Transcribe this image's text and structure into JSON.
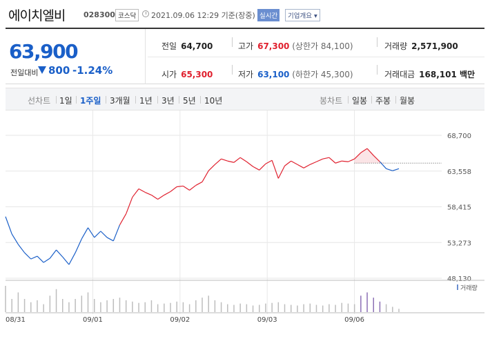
{
  "header": {
    "name": "에이치엘비",
    "code": "028300",
    "market": "코스닥",
    "timestamp": "2021.09.06 12:29 기준(장중)",
    "realtime_label": "실시간",
    "company_label": "기업개요 ▾"
  },
  "price": {
    "current": "63,900",
    "change_label": "전일대비",
    "change": "800",
    "change_pct": "-1.24%"
  },
  "stats": {
    "prev_label": "전일",
    "prev": "64,700",
    "high_label": "고가",
    "high": "67,300",
    "upper_limit": "(상한가 84,100)",
    "volume_label": "거래량",
    "volume": "2,571,900",
    "open_label": "시가",
    "open": "65,300",
    "low_label": "저가",
    "low": "63,100",
    "lower_limit": "(하한가 45,300)",
    "amount_label": "거래대금",
    "amount": "168,101 백만"
  },
  "tabs": {
    "line_chart_label": "선차트",
    "periods": [
      "1일",
      "1주일",
      "3개월",
      "1년",
      "3년",
      "5년",
      "10년"
    ],
    "active_period": "1주일",
    "candle_chart_label": "봉차트",
    "candles": [
      "일봉",
      "주봉",
      "월봉"
    ]
  },
  "colors": {
    "up": "#e0202e",
    "down": "#1a5fc8",
    "accent": "#1a5fc8"
  },
  "chart_data": {
    "type": "line",
    "xlabel": "",
    "ylabel": "",
    "x": [
      "08/31",
      "09/01",
      "09/02",
      "09/03",
      "09/06"
    ],
    "yticks": [
      "68,700",
      "63,558",
      "58,415",
      "53,273",
      "48,130"
    ],
    "ylim": [
      48130,
      68700
    ],
    "reference_line": 64700,
    "series": [
      {
        "values": [
          57000,
          54500,
          53000,
          51800,
          50900,
          51300,
          50400,
          51000,
          52200,
          51200,
          50100,
          51800,
          53800,
          55400,
          54000,
          54900,
          54000,
          53500,
          55800,
          57400,
          59800,
          61000,
          60500,
          60100,
          59500,
          60100,
          60600,
          61300,
          61400,
          60800,
          61500,
          62000,
          63600,
          64500,
          65300,
          65000,
          64800,
          65500,
          64900,
          64200,
          63700,
          64600,
          65100,
          62500,
          64300,
          65000,
          64500,
          64000,
          64500,
          64900,
          65300,
          65500,
          64700,
          65000,
          64900,
          65300,
          66200,
          66800,
          65800,
          64900,
          63900,
          63600,
          63900
        ]
      }
    ],
    "grid": "horizontal",
    "volume_legend": "거래량",
    "volume_series": [
      4,
      2,
      3,
      2,
      1.5,
      1.8,
      1.2,
      2.5,
      3.5,
      2,
      1.5,
      2,
      2.5,
      3,
      2,
      1.5,
      1.8,
      2,
      2.2,
      1.8,
      1.6,
      1.4,
      1.5,
      1.8,
      1.2,
      1.3,
      1.4,
      1.6,
      1.5,
      1.2,
      1.8,
      2.2,
      2.5,
      1.8,
      1.5,
      1.2,
      1.1,
      1.3,
      1.2,
      1.0,
      1.1,
      1.3,
      1.4,
      1.5,
      1.2,
      1.1,
      1.0,
      1.2,
      1.3,
      1.1,
      1.0,
      1.2,
      1.1,
      1.4,
      1.3,
      1.2,
      2.5,
      3.0,
      2.2,
      1.6,
      1.2,
      0.8,
      0.5
    ]
  }
}
